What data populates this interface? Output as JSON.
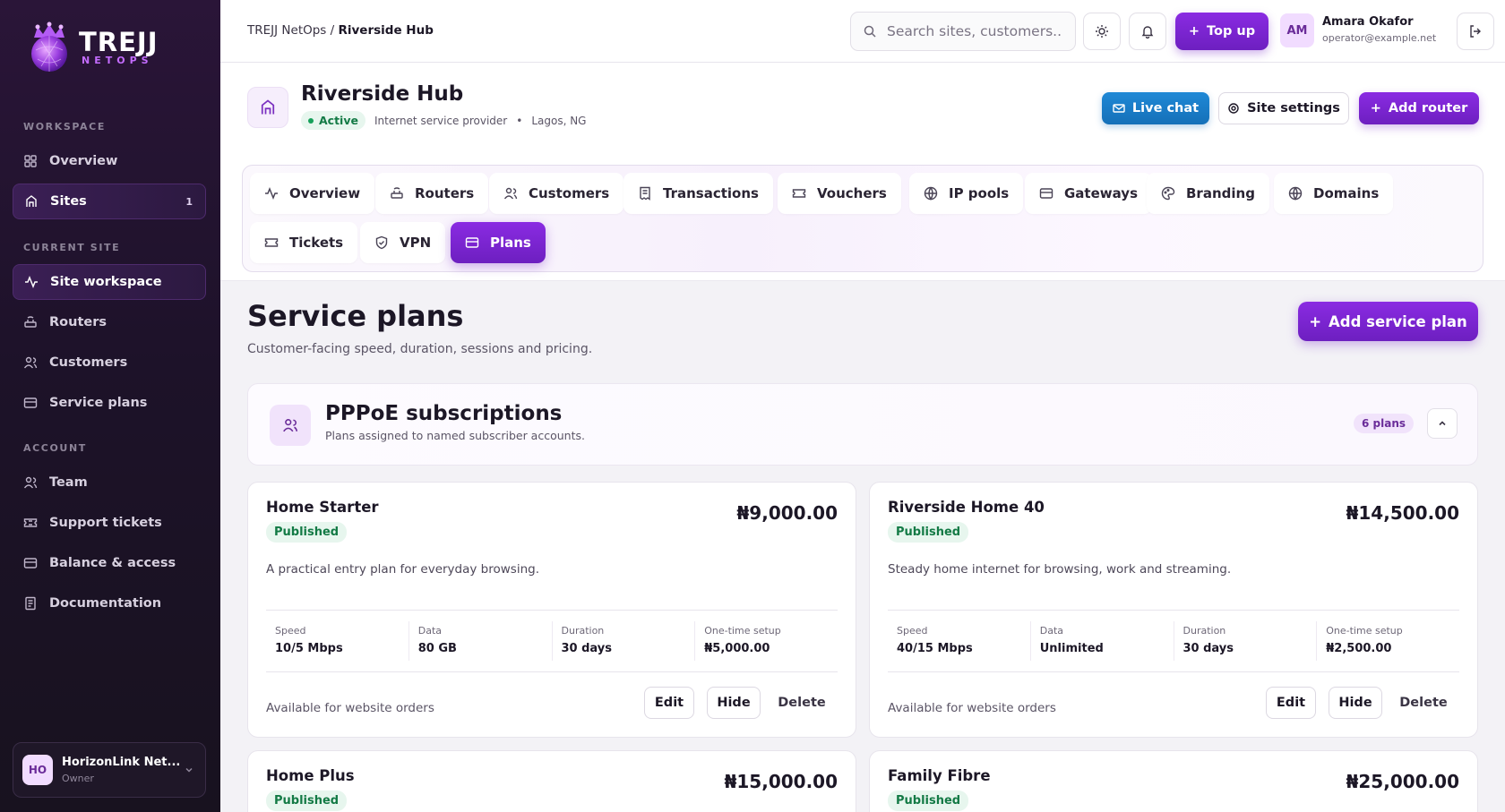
{
  "brand": {
    "name": "TREJJ",
    "sub": "NETOPS"
  },
  "sidebar": {
    "sections": [
      {
        "label": "WORKSPACE"
      },
      {
        "label": "CURRENT SITE"
      },
      {
        "label": "ACCOUNT"
      }
    ],
    "items": [
      {
        "label": "Overview",
        "icon": "grid-icon"
      },
      {
        "label": "Sites",
        "icon": "building-icon",
        "badge": "1",
        "active": true
      },
      {
        "label": "Site workspace",
        "icon": "activity-icon",
        "active": true
      },
      {
        "label": "Routers",
        "icon": "router-icon"
      },
      {
        "label": "Customers",
        "icon": "users-icon"
      },
      {
        "label": "Service plans",
        "icon": "card-icon"
      },
      {
        "label": "Team",
        "icon": "users-icon"
      },
      {
        "label": "Support tickets",
        "icon": "ticket-icon"
      },
      {
        "label": "Balance & access",
        "icon": "card-icon"
      },
      {
        "label": "Documentation",
        "icon": "doc-icon"
      }
    ],
    "org": {
      "initials": "HO",
      "name": "HorizonLink Net...",
      "role": "Owner"
    }
  },
  "topbar": {
    "breadcrumb_root": "TREJJ NetOps /",
    "breadcrumb_current": "Riverside Hub",
    "search_placeholder": "Search sites, customers...",
    "topup_label": "Top up",
    "user": {
      "initials": "AM",
      "name": "Amara Okafor",
      "email": "operator@example.net"
    }
  },
  "site": {
    "name": "Riverside Hub",
    "status": "Active",
    "type": "Internet service provider",
    "location": "Lagos, NG",
    "live_chat": "Live chat",
    "settings": "Site settings",
    "add_router": "Add router"
  },
  "tabs": [
    {
      "label": "Overview",
      "icon": "activity-icon"
    },
    {
      "label": "Routers",
      "icon": "router-icon"
    },
    {
      "label": "Customers",
      "icon": "users-icon"
    },
    {
      "label": "Transactions",
      "icon": "receipt-icon"
    },
    {
      "label": "Vouchers",
      "icon": "ticket-icon"
    },
    {
      "label": "IP pools",
      "icon": "globe-icon"
    },
    {
      "label": "Gateways",
      "icon": "card-icon"
    },
    {
      "label": "Branding",
      "icon": "palette-icon"
    },
    {
      "label": "Domains",
      "icon": "globe-icon"
    },
    {
      "label": "Tickets",
      "icon": "ticket-icon"
    },
    {
      "label": "VPN",
      "icon": "shield-icon"
    },
    {
      "label": "Plans",
      "icon": "card-icon",
      "active": true
    }
  ],
  "main": {
    "title": "Service plans",
    "subtitle": "Customer-facing speed, duration, sessions and pricing.",
    "add_plan": "Add service plan",
    "group": {
      "title": "PPPoE subscriptions",
      "description": "Plans assigned to named subscriber accounts.",
      "count": "6 plans"
    },
    "stat_labels": {
      "speed": "Speed",
      "data": "Data",
      "duration": "Duration",
      "setup": "One-time setup"
    },
    "actions": {
      "edit": "Edit",
      "hide": "Hide",
      "delete": "Delete"
    },
    "plans": [
      {
        "name": "Home Starter",
        "status": "Published",
        "price": "₦9,000.00",
        "description": "A practical entry plan for everyday browsing.",
        "speed": "10/5 Mbps",
        "data": "80 GB",
        "duration": "30 days",
        "setup": "₦5,000.00",
        "availability": "Available for website orders"
      },
      {
        "name": "Riverside Home 40",
        "status": "Published",
        "price": "₦14,500.00",
        "description": "Steady home internet for browsing, work and streaming.",
        "speed": "40/15 Mbps",
        "data": "Unlimited",
        "duration": "30 days",
        "setup": "₦2,500.00",
        "availability": "Available for website orders"
      },
      {
        "name": "Home Plus",
        "status": "Published",
        "price": "₦15,000.00"
      },
      {
        "name": "Family Fibre",
        "status": "Published",
        "price": "₦25,000.00"
      }
    ]
  }
}
